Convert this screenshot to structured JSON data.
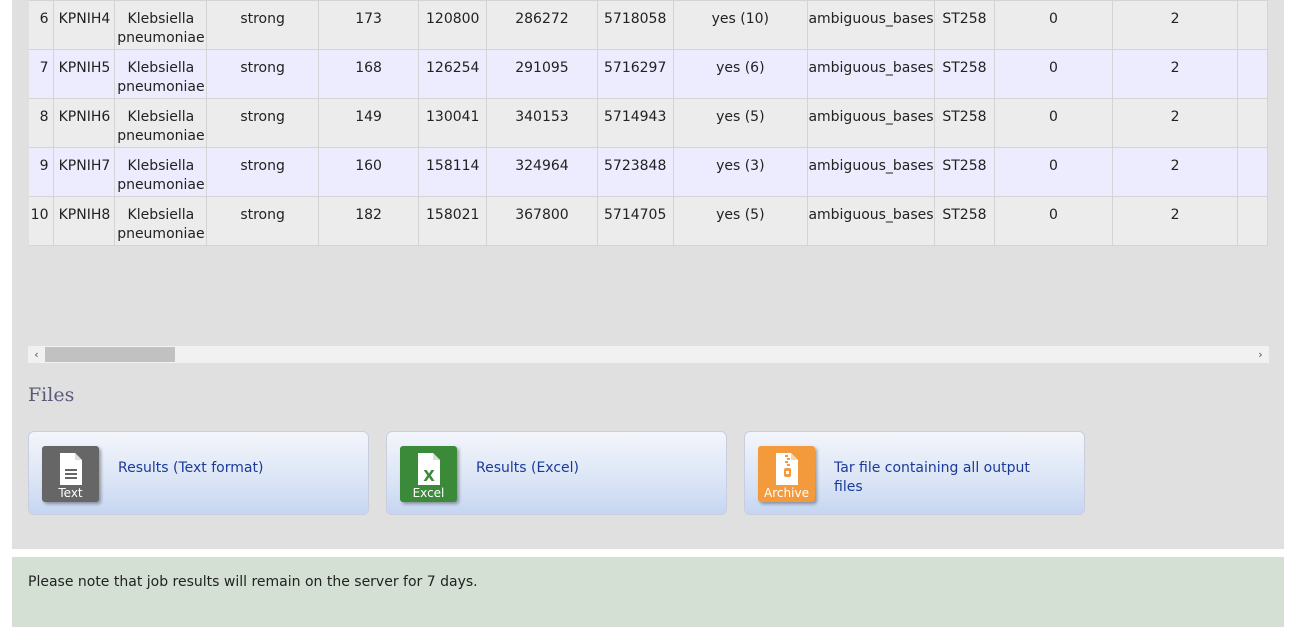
{
  "table": {
    "partial_row": {
      "species_line2": "pneumoniae"
    },
    "rows": [
      {
        "num": "6",
        "id": "KPNIH4",
        "species": "Klebsiella pneumoniae",
        "match": "strong",
        "c4": "173",
        "c5": "120800",
        "c6": "286272",
        "c7": "5718058",
        "c8": "yes (10)",
        "c9": "ambiguous_bases",
        "c10": "ST258",
        "c11": "0",
        "c12": "2"
      },
      {
        "num": "7",
        "id": "KPNIH5",
        "species": "Klebsiella pneumoniae",
        "match": "strong",
        "c4": "168",
        "c5": "126254",
        "c6": "291095",
        "c7": "5716297",
        "c8": "yes (6)",
        "c9": "ambiguous_bases",
        "c10": "ST258",
        "c11": "0",
        "c12": "2"
      },
      {
        "num": "8",
        "id": "KPNIH6",
        "species": "Klebsiella pneumoniae",
        "match": "strong",
        "c4": "149",
        "c5": "130041",
        "c6": "340153",
        "c7": "5714943",
        "c8": "yes (5)",
        "c9": "ambiguous_bases",
        "c10": "ST258",
        "c11": "0",
        "c12": "2"
      },
      {
        "num": "9",
        "id": "KPNIH7",
        "species": "Klebsiella pneumoniae",
        "match": "strong",
        "c4": "160",
        "c5": "158114",
        "c6": "324964",
        "c7": "5723848",
        "c8": "yes (3)",
        "c9": "ambiguous_bases",
        "c10": "ST258",
        "c11": "0",
        "c12": "2"
      },
      {
        "num": "10",
        "id": "KPNIH8",
        "species": "Klebsiella pneumoniae",
        "match": "strong",
        "c4": "182",
        "c5": "158021",
        "c6": "367800",
        "c7": "5714705",
        "c8": "yes (5)",
        "c9": "ambiguous_bases",
        "c10": "ST258",
        "c11": "0",
        "c12": "2"
      }
    ]
  },
  "scrollbar": {
    "left_arrow": "‹",
    "right_arrow": "›"
  },
  "files": {
    "heading": "Files",
    "items": [
      {
        "icon": "text-file-icon",
        "icon_label": "Text",
        "link": "Results (Text format)",
        "color": "#666666"
      },
      {
        "icon": "excel-file-icon",
        "icon_label": "Excel",
        "link": "Results (Excel)",
        "color": "#3a8a3a"
      },
      {
        "icon": "archive-file-icon",
        "icon_label": "Archive",
        "link": "Tar file containing all output files",
        "color": "#f39a3c"
      }
    ]
  },
  "note": {
    "text": "Please note that job results will remain on the server for 7 days."
  }
}
